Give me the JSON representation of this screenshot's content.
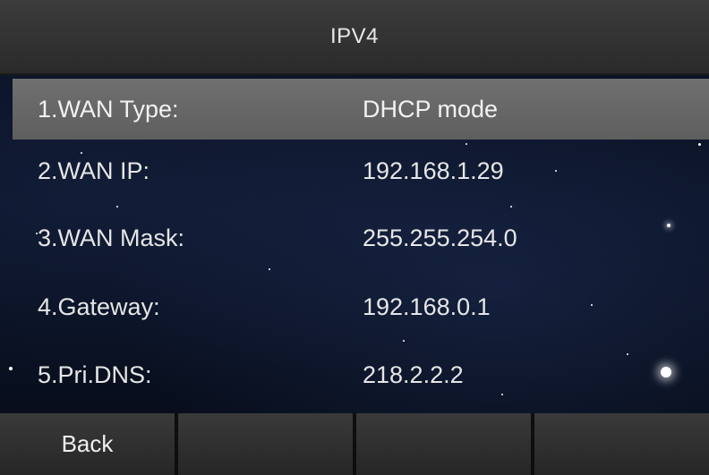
{
  "title": "IPV4",
  "rows": [
    {
      "label": "1.WAN Type:",
      "value": "DHCP mode"
    },
    {
      "label": "2.WAN IP:",
      "value": "192.168.1.29"
    },
    {
      "label": "3.WAN Mask:",
      "value": "255.255.254.0"
    },
    {
      "label": "4.Gateway:",
      "value": "192.168.0.1"
    },
    {
      "label": "5.Pri.DNS:",
      "value": "218.2.2.2"
    }
  ],
  "selected_row_index": 0,
  "softkeys": [
    "Back",
    "",
    "",
    ""
  ],
  "colors": {
    "titlebar": "#333333",
    "selected_row": "#666666",
    "background": "#0b1428",
    "text": "#e6e6e6"
  }
}
